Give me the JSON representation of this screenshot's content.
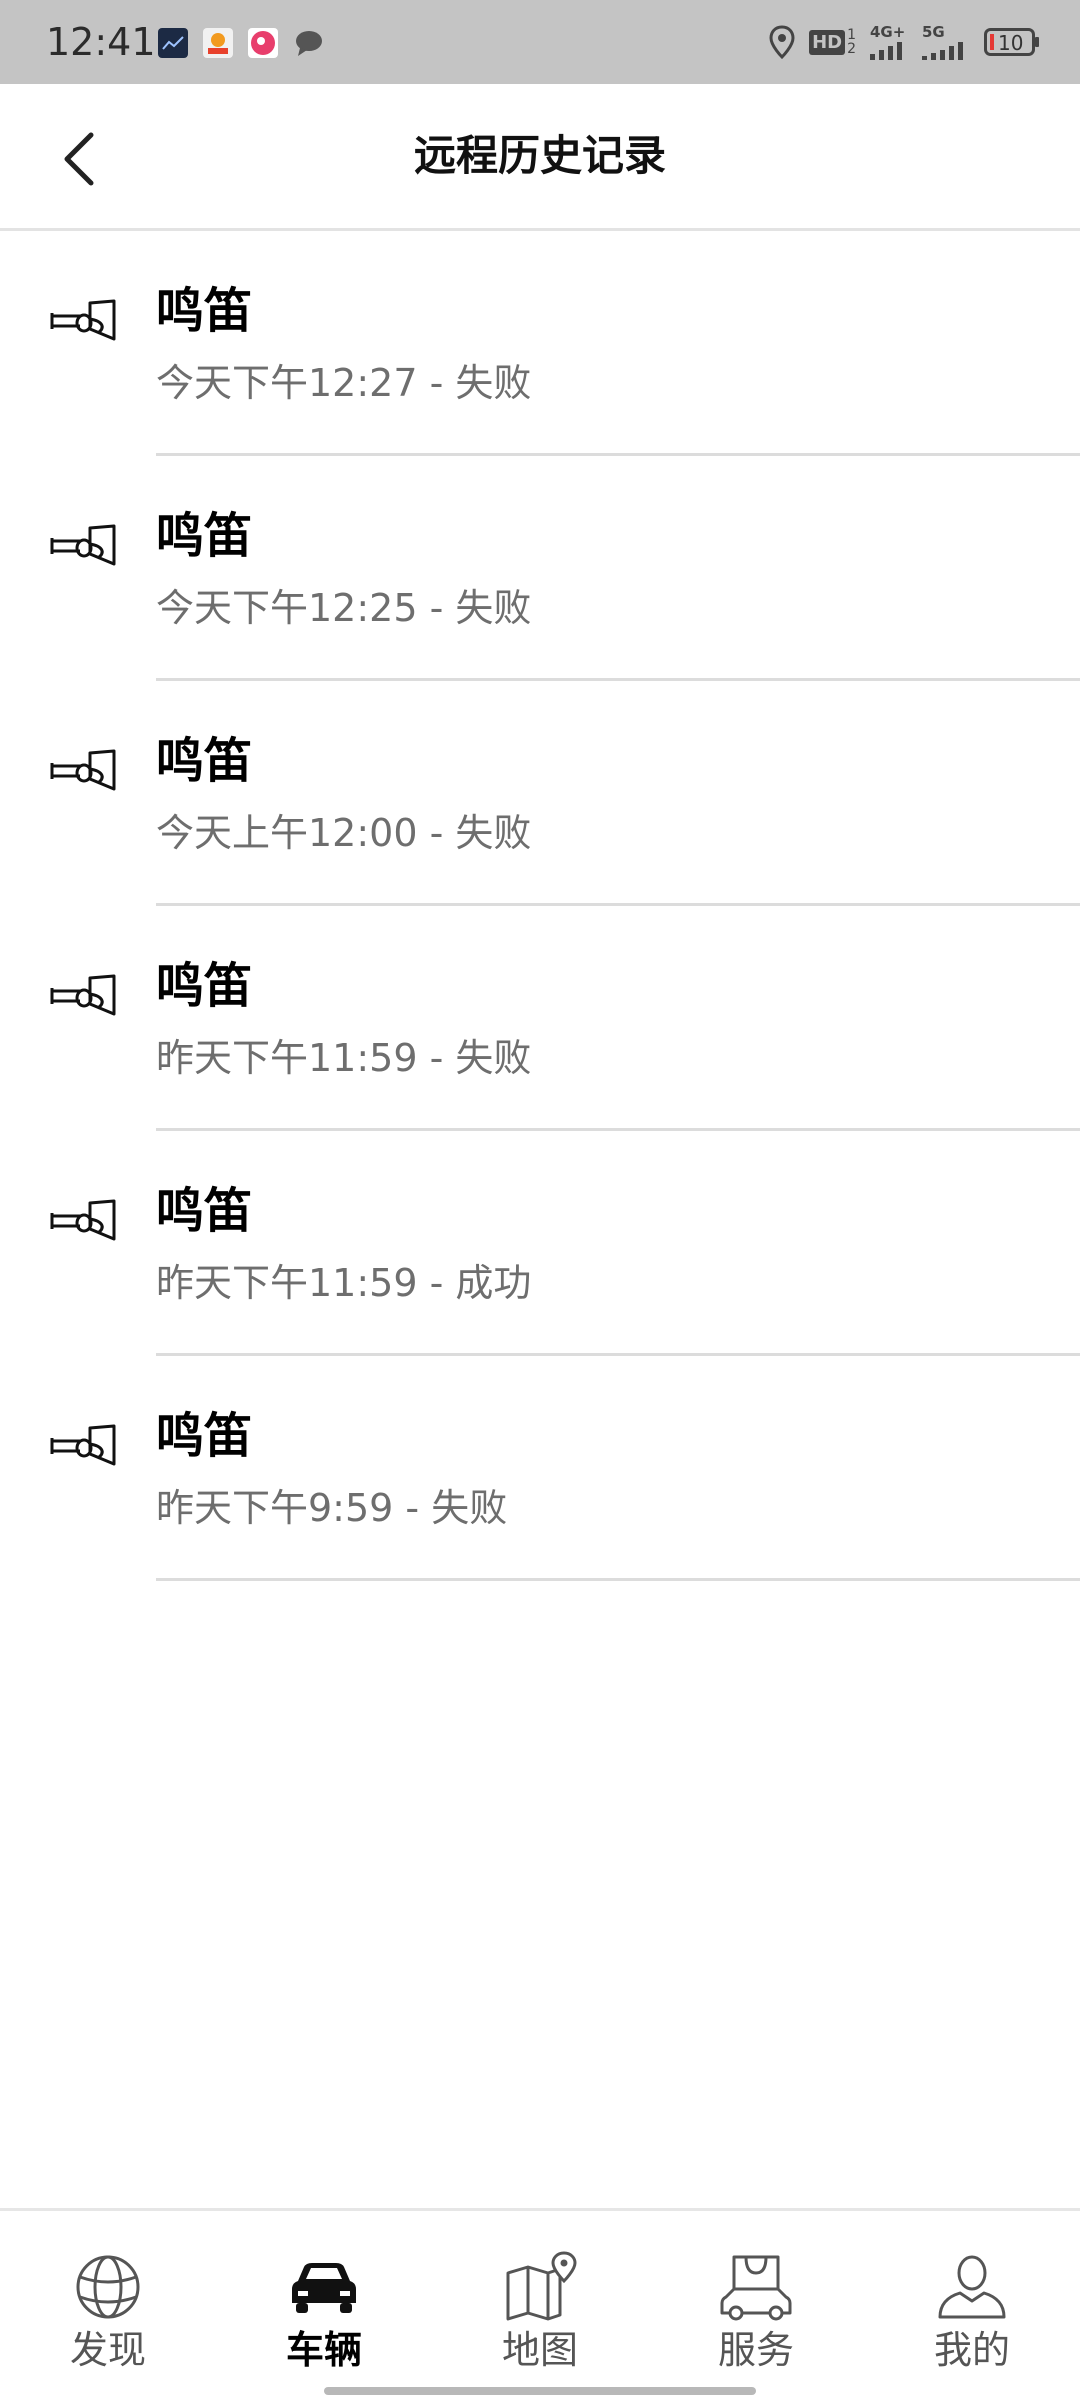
{
  "status_bar": {
    "time": "12:41",
    "battery": "10",
    "network_4g": "4G+",
    "network_5g": "5G",
    "hd_label": "HD"
  },
  "header": {
    "title": "远程历史记录",
    "back_icon": "chevron-left-icon"
  },
  "history": {
    "icon": "horn-icon",
    "items": [
      {
        "title": "鸣笛",
        "subtitle": "今天下午12:27 - 失败"
      },
      {
        "title": "鸣笛",
        "subtitle": "今天下午12:25 - 失败"
      },
      {
        "title": "鸣笛",
        "subtitle": "今天上午12:00 - 失败"
      },
      {
        "title": "鸣笛",
        "subtitle": "昨天下午11:59 - 失败"
      },
      {
        "title": "鸣笛",
        "subtitle": "昨天下午11:59 - 成功"
      },
      {
        "title": "鸣笛",
        "subtitle": "昨天下午9:59 - 失败"
      }
    ]
  },
  "bottom_nav": {
    "active_index": 1,
    "items": [
      {
        "label": "发现",
        "icon": "globe-icon"
      },
      {
        "label": "车辆",
        "icon": "car-icon"
      },
      {
        "label": "地图",
        "icon": "map-icon"
      },
      {
        "label": "服务",
        "icon": "shopping-bag-car-icon"
      },
      {
        "label": "我的",
        "icon": "user-icon"
      }
    ]
  },
  "colors": {
    "status_bar_bg": "#c4c4c4",
    "text_primary": "#000000",
    "text_secondary": "#6e6e6e",
    "divider": "#dcdcdc",
    "battery_low": "#e53935"
  }
}
